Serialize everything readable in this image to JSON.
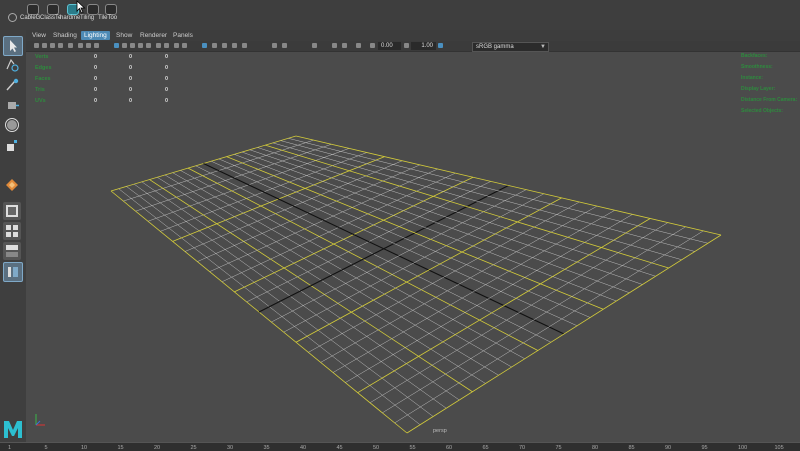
{
  "shelf": {
    "items": [
      {
        "label": "CableG",
        "icon": "cable-shelf-icon"
      },
      {
        "label": "ClassTe",
        "icon": "class-shelf-icon"
      },
      {
        "label": "hardme",
        "icon": "hardmesh-shelf-icon",
        "highlight": true
      },
      {
        "label": "Tiling",
        "icon": "tiling-shelf-icon"
      },
      {
        "label": "TileToo",
        "icon": "tiletool-shelf-icon"
      }
    ]
  },
  "panel_menu": {
    "items": [
      "View",
      "Shading",
      "Lighting",
      "Show",
      "Renderer",
      "Panels"
    ],
    "active": "Lighting"
  },
  "panel_toolbar": {
    "exposure": "0.00",
    "gamma": "1.00",
    "color_space": "sRGB gamma"
  },
  "hud": {
    "left_rows": [
      {
        "label": "Verts",
        "values": [
          "0",
          "0",
          "0"
        ]
      },
      {
        "label": "Edges",
        "values": [
          "0",
          "0",
          "0"
        ]
      },
      {
        "label": "Faces",
        "values": [
          "0",
          "0",
          "0"
        ]
      },
      {
        "label": "Tris",
        "values": [
          "0",
          "0",
          "0"
        ]
      },
      {
        "label": "UVs",
        "values": [
          "0",
          "0",
          "0"
        ]
      }
    ],
    "right_rows": [
      "Backfaces:",
      "Smoothness:",
      "Instance:",
      "Display Layer:",
      "Distance From Camera:",
      "Selected Objects:"
    ]
  },
  "camera": "persp",
  "timeline": {
    "ticks": [
      "1",
      "5",
      "10",
      "15",
      "20",
      "25",
      "30",
      "35",
      "40",
      "45",
      "50",
      "55",
      "60",
      "65",
      "70",
      "75",
      "80",
      "85",
      "90",
      "95",
      "100",
      "105"
    ]
  },
  "colors": {
    "viewport_bg": "#4b4b4b",
    "grid": "#bdbdbd",
    "grid_major": "#d4cc3a",
    "axis": "#111111",
    "hud_label": "#2e8b3e"
  }
}
